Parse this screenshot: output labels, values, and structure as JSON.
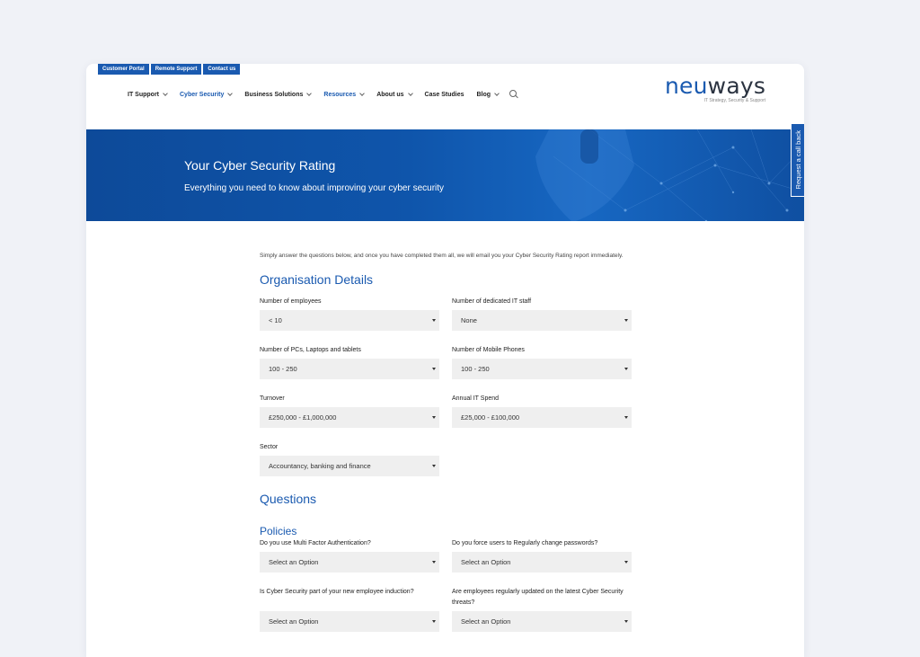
{
  "topbar": [
    "Customer Portal",
    "Remote Support",
    "Contact us"
  ],
  "nav": [
    {
      "label": "IT Support",
      "dropdown": true,
      "active": false
    },
    {
      "label": "Cyber Security",
      "dropdown": true,
      "active": true
    },
    {
      "label": "Business Solutions",
      "dropdown": true,
      "active": false
    },
    {
      "label": "Resources",
      "dropdown": true,
      "active": true
    },
    {
      "label": "About us",
      "dropdown": true,
      "active": false
    },
    {
      "label": "Case Studies",
      "dropdown": false,
      "active": false
    },
    {
      "label": "Blog",
      "dropdown": true,
      "active": false
    }
  ],
  "logo": {
    "part1": "neu",
    "part2": "ways",
    "tagline": "IT Strategy, Security & Support"
  },
  "hero": {
    "title": "Your Cyber Security Rating",
    "subtitle": "Everything you need to know about improving your cyber security"
  },
  "callback": "Request a call back",
  "intro": "Simply answer the questions below, and once you have completed them all, we will email you your Cyber Security Rating report immediately.",
  "sections": {
    "organisation": "Organisation Details",
    "questions": "Questions",
    "policies": "Policies"
  },
  "org_fields": [
    {
      "label": "Number of employees",
      "value": "< 10"
    },
    {
      "label": "Number of dedicated IT staff",
      "value": "None"
    },
    {
      "label": "Number of PCs, Laptops and tablets",
      "value": "100 - 250"
    },
    {
      "label": "Number of Mobile Phones",
      "value": "100 - 250"
    },
    {
      "label": "Turnover",
      "value": "£250,000 - £1,000,000"
    },
    {
      "label": "Annual IT Spend",
      "value": "£25,000 - £100,000"
    },
    {
      "label": "Sector",
      "value": "Accountancy, banking and finance"
    }
  ],
  "policy_fields": [
    {
      "label": "Do you use Multi Factor Authentication?",
      "value": "Select an Option"
    },
    {
      "label": "Do you force users to Regularly change passwords?",
      "value": "Select an Option"
    },
    {
      "label": "Is Cyber Security part of your new employee induction?",
      "value": "Select an Option"
    },
    {
      "label": "Are employees regularly updated on the latest Cyber Security threats?",
      "value": "Select an Option"
    }
  ],
  "colors": {
    "brand_blue": "#1a5ab0",
    "hero_blue": "#0f55ab",
    "select_bg": "#efefef",
    "page_bg": "#f0f2f7"
  }
}
